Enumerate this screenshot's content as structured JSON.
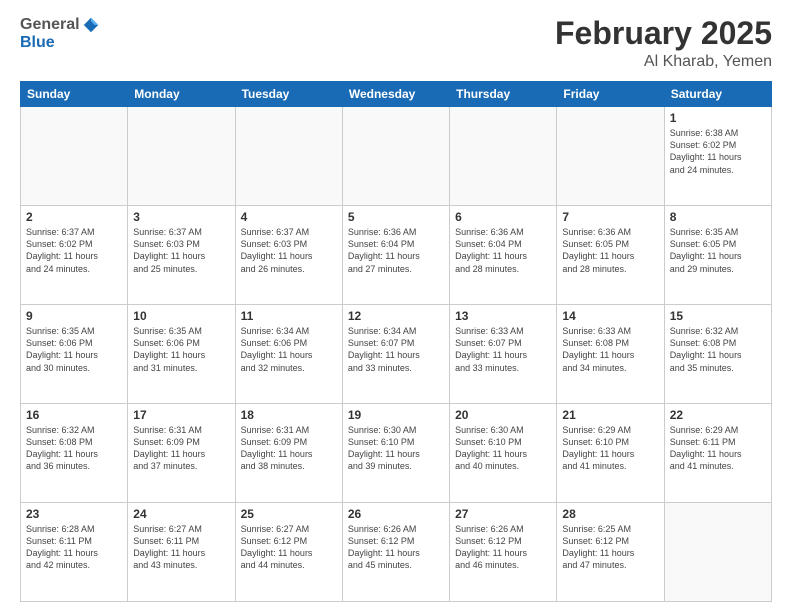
{
  "logo": {
    "general": "General",
    "blue": "Blue"
  },
  "header": {
    "title": "February 2025",
    "subtitle": "Al Kharab, Yemen"
  },
  "weekdays": [
    "Sunday",
    "Monday",
    "Tuesday",
    "Wednesday",
    "Thursday",
    "Friday",
    "Saturday"
  ],
  "weeks": [
    [
      {
        "day": "",
        "info": ""
      },
      {
        "day": "",
        "info": ""
      },
      {
        "day": "",
        "info": ""
      },
      {
        "day": "",
        "info": ""
      },
      {
        "day": "",
        "info": ""
      },
      {
        "day": "",
        "info": ""
      },
      {
        "day": "1",
        "info": "Sunrise: 6:38 AM\nSunset: 6:02 PM\nDaylight: 11 hours\nand 24 minutes."
      }
    ],
    [
      {
        "day": "2",
        "info": "Sunrise: 6:37 AM\nSunset: 6:02 PM\nDaylight: 11 hours\nand 24 minutes."
      },
      {
        "day": "3",
        "info": "Sunrise: 6:37 AM\nSunset: 6:03 PM\nDaylight: 11 hours\nand 25 minutes."
      },
      {
        "day": "4",
        "info": "Sunrise: 6:37 AM\nSunset: 6:03 PM\nDaylight: 11 hours\nand 26 minutes."
      },
      {
        "day": "5",
        "info": "Sunrise: 6:36 AM\nSunset: 6:04 PM\nDaylight: 11 hours\nand 27 minutes."
      },
      {
        "day": "6",
        "info": "Sunrise: 6:36 AM\nSunset: 6:04 PM\nDaylight: 11 hours\nand 28 minutes."
      },
      {
        "day": "7",
        "info": "Sunrise: 6:36 AM\nSunset: 6:05 PM\nDaylight: 11 hours\nand 28 minutes."
      },
      {
        "day": "8",
        "info": "Sunrise: 6:35 AM\nSunset: 6:05 PM\nDaylight: 11 hours\nand 29 minutes."
      }
    ],
    [
      {
        "day": "9",
        "info": "Sunrise: 6:35 AM\nSunset: 6:06 PM\nDaylight: 11 hours\nand 30 minutes."
      },
      {
        "day": "10",
        "info": "Sunrise: 6:35 AM\nSunset: 6:06 PM\nDaylight: 11 hours\nand 31 minutes."
      },
      {
        "day": "11",
        "info": "Sunrise: 6:34 AM\nSunset: 6:06 PM\nDaylight: 11 hours\nand 32 minutes."
      },
      {
        "day": "12",
        "info": "Sunrise: 6:34 AM\nSunset: 6:07 PM\nDaylight: 11 hours\nand 33 minutes."
      },
      {
        "day": "13",
        "info": "Sunrise: 6:33 AM\nSunset: 6:07 PM\nDaylight: 11 hours\nand 33 minutes."
      },
      {
        "day": "14",
        "info": "Sunrise: 6:33 AM\nSunset: 6:08 PM\nDaylight: 11 hours\nand 34 minutes."
      },
      {
        "day": "15",
        "info": "Sunrise: 6:32 AM\nSunset: 6:08 PM\nDaylight: 11 hours\nand 35 minutes."
      }
    ],
    [
      {
        "day": "16",
        "info": "Sunrise: 6:32 AM\nSunset: 6:08 PM\nDaylight: 11 hours\nand 36 minutes."
      },
      {
        "day": "17",
        "info": "Sunrise: 6:31 AM\nSunset: 6:09 PM\nDaylight: 11 hours\nand 37 minutes."
      },
      {
        "day": "18",
        "info": "Sunrise: 6:31 AM\nSunset: 6:09 PM\nDaylight: 11 hours\nand 38 minutes."
      },
      {
        "day": "19",
        "info": "Sunrise: 6:30 AM\nSunset: 6:10 PM\nDaylight: 11 hours\nand 39 minutes."
      },
      {
        "day": "20",
        "info": "Sunrise: 6:30 AM\nSunset: 6:10 PM\nDaylight: 11 hours\nand 40 minutes."
      },
      {
        "day": "21",
        "info": "Sunrise: 6:29 AM\nSunset: 6:10 PM\nDaylight: 11 hours\nand 41 minutes."
      },
      {
        "day": "22",
        "info": "Sunrise: 6:29 AM\nSunset: 6:11 PM\nDaylight: 11 hours\nand 41 minutes."
      }
    ],
    [
      {
        "day": "23",
        "info": "Sunrise: 6:28 AM\nSunset: 6:11 PM\nDaylight: 11 hours\nand 42 minutes."
      },
      {
        "day": "24",
        "info": "Sunrise: 6:27 AM\nSunset: 6:11 PM\nDaylight: 11 hours\nand 43 minutes."
      },
      {
        "day": "25",
        "info": "Sunrise: 6:27 AM\nSunset: 6:12 PM\nDaylight: 11 hours\nand 44 minutes."
      },
      {
        "day": "26",
        "info": "Sunrise: 6:26 AM\nSunset: 6:12 PM\nDaylight: 11 hours\nand 45 minutes."
      },
      {
        "day": "27",
        "info": "Sunrise: 6:26 AM\nSunset: 6:12 PM\nDaylight: 11 hours\nand 46 minutes."
      },
      {
        "day": "28",
        "info": "Sunrise: 6:25 AM\nSunset: 6:12 PM\nDaylight: 11 hours\nand 47 minutes."
      },
      {
        "day": "",
        "info": ""
      }
    ]
  ]
}
